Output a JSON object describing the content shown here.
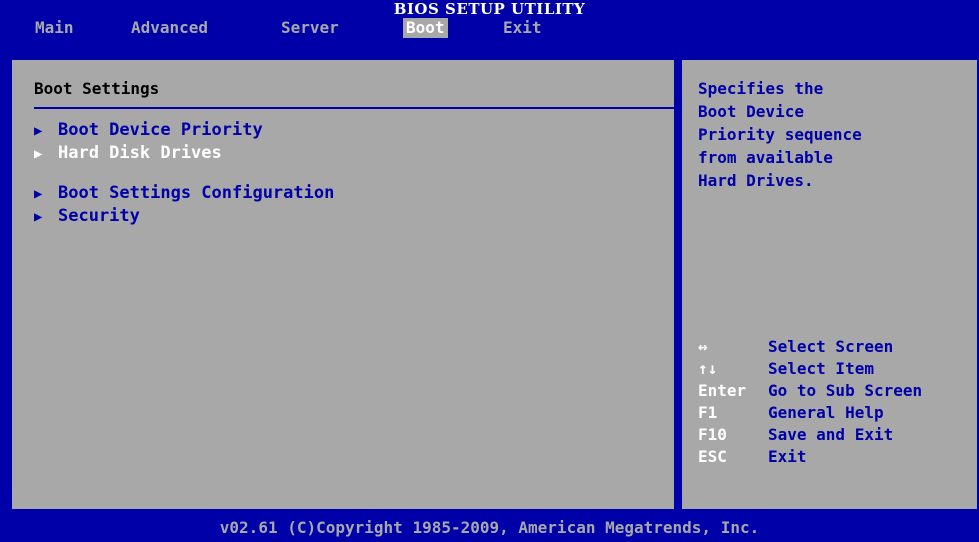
{
  "title": "BIOS SETUP UTILITY",
  "menu": [
    {
      "label": "Main"
    },
    {
      "label": "Advanced"
    },
    {
      "label": "Server"
    },
    {
      "label": "Boot"
    },
    {
      "label": "Exit"
    }
  ],
  "active_tab": "Boot",
  "main": {
    "section_title": "Boot Settings",
    "items": [
      {
        "label": "Boot Device Priority",
        "icon": "triangle-right-icon"
      },
      {
        "label": "Hard Disk Drives",
        "icon": "triangle-right-icon"
      },
      {
        "label": "Boot Settings Configuration",
        "icon": "triangle-right-icon"
      },
      {
        "label": "Security",
        "icon": "triangle-right-icon"
      }
    ],
    "selected_item": "Hard Disk Drives"
  },
  "help": {
    "text": "Specifies the\nBoot Device\nPriority sequence\nfrom available\nHard Drives.",
    "keys": [
      {
        "key": "↔",
        "desc": "Select Screen"
      },
      {
        "key": "↑↓",
        "desc": "Select Item"
      },
      {
        "key": "Enter",
        "desc": "Go to Sub Screen"
      },
      {
        "key": "F1",
        "desc": "General Help"
      },
      {
        "key": "F10",
        "desc": "Save and Exit"
      },
      {
        "key": "ESC",
        "desc": "Exit"
      }
    ]
  },
  "footer": "v02.61 (C)Copyright 1985-2009, American Megatrends, Inc.",
  "colors": {
    "background": "#0000a8",
    "panel": "#a8a8a8",
    "text_highlight": "#ffffff",
    "text_normal": "#0000a8"
  }
}
